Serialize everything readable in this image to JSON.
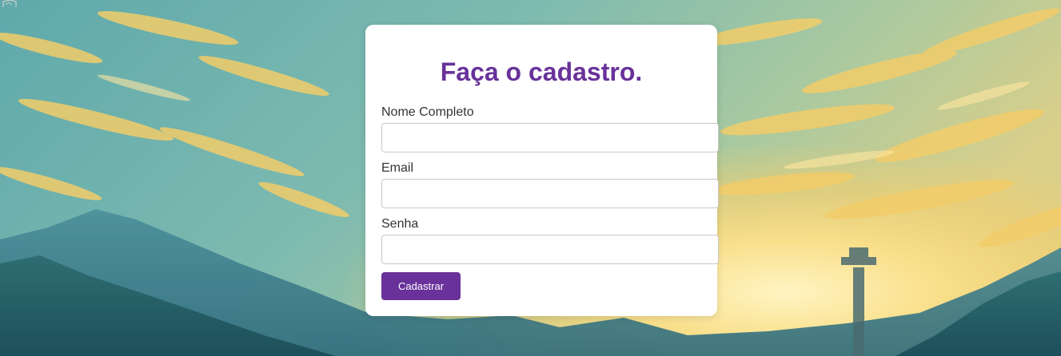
{
  "form": {
    "title": "Faça o cadastro.",
    "fields": [
      {
        "label": "Nome Completo",
        "value": ""
      },
      {
        "label": "Email",
        "value": ""
      },
      {
        "label": "Senha",
        "value": ""
      }
    ],
    "submit_label": "Cadastrar"
  },
  "colors": {
    "accent": "#68329a",
    "card_background": "#ffffff",
    "label_text": "#333333",
    "input_border": "#c9c9c9"
  },
  "icons": {
    "top_left": "broken-image-icon"
  }
}
